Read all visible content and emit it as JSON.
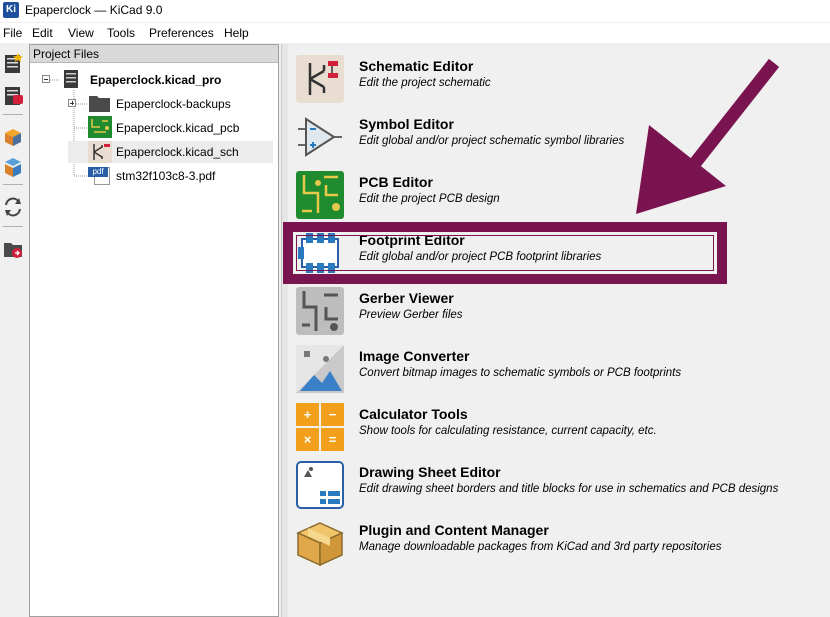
{
  "window": {
    "title": "Epaperclock — KiCad 9.0",
    "app_icon_text": "Ki"
  },
  "menu": [
    "File",
    "Edit",
    "View",
    "Tools",
    "Preferences",
    "Help"
  ],
  "project_panel": {
    "header": "Project Files",
    "tree": [
      {
        "label": "Epaperclock.kicad_pro",
        "bold": true,
        "icon": "project-file-icon"
      },
      {
        "label": "Epaperclock-backups",
        "icon": "folder-icon"
      },
      {
        "label": "Epaperclock.kicad_pcb",
        "icon": "pcb-file-icon"
      },
      {
        "label": "Epaperclock.kicad_sch",
        "icon": "schematic-file-icon"
      },
      {
        "label": "stm32f103c8-3.pdf",
        "icon": "pdf-file-icon",
        "icon_text": "pdf"
      }
    ]
  },
  "tools": [
    {
      "name": "Schematic Editor",
      "desc": "Edit the project schematic",
      "icon": "schematic-editor-icon"
    },
    {
      "name": "Symbol Editor",
      "desc": "Edit global and/or project schematic symbol libraries",
      "icon": "symbol-editor-icon"
    },
    {
      "name": "PCB Editor",
      "desc": "Edit the project PCB design",
      "icon": "pcb-editor-icon"
    },
    {
      "name": "Footprint Editor",
      "desc": "Edit global and/or project PCB footprint libraries",
      "icon": "footprint-editor-icon"
    },
    {
      "name": "Gerber Viewer",
      "desc": "Preview Gerber files",
      "icon": "gerber-viewer-icon"
    },
    {
      "name": "Image Converter",
      "desc": "Convert bitmap images to schematic symbols or PCB footprints",
      "icon": "image-converter-icon"
    },
    {
      "name": "Calculator Tools",
      "desc": "Show tools for calculating resistance, current capacity, etc.",
      "icon": "calculator-tools-icon",
      "icon_symbols": [
        "+",
        "−",
        "×",
        "="
      ]
    },
    {
      "name": "Drawing Sheet Editor",
      "desc": "Edit drawing sheet borders and title blocks for use in schematics and PCB designs",
      "icon": "drawing-sheet-editor-icon"
    },
    {
      "name": "Plugin and Content Manager",
      "desc": "Manage downloadable packages from KiCad and 3rd party repositories",
      "icon": "plugin-content-manager-icon"
    }
  ],
  "annotation": {
    "color": "#7a1450",
    "highlighted_tool": "Footprint Editor"
  }
}
